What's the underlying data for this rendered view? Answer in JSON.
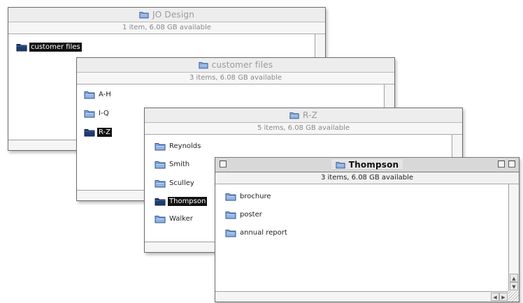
{
  "icons": {
    "folder": "folder-icon",
    "open_folder": "open-folder-icon"
  },
  "colors": {
    "selection": "#111111",
    "folder_blue": "#8fb4e6",
    "folder_dark": "#1f3c6e"
  },
  "windows": {
    "jo_design": {
      "title": "JO Design",
      "info": "1 item, 6.08 GB available",
      "items": [
        {
          "label": "customer files",
          "selected": true
        }
      ]
    },
    "customer_files": {
      "title": "customer files",
      "info": "3 items, 6.08 GB available",
      "items": [
        {
          "label": "A-H",
          "selected": false
        },
        {
          "label": "I-Q",
          "selected": false
        },
        {
          "label": "R-Z",
          "selected": true
        }
      ]
    },
    "r_z": {
      "title": "R-Z",
      "info": "5 items, 6.08 GB available",
      "items": [
        {
          "label": "Reynolds",
          "selected": false
        },
        {
          "label": "Smith",
          "selected": false
        },
        {
          "label": "Sculley",
          "selected": false
        },
        {
          "label": "Thompson",
          "selected": true
        },
        {
          "label": "Walker",
          "selected": false
        }
      ]
    },
    "thompson": {
      "title": "Thompson",
      "info": "3 items, 6.08 GB available",
      "items": [
        {
          "label": "brochure",
          "selected": false
        },
        {
          "label": "poster",
          "selected": false
        },
        {
          "label": "annual report",
          "selected": false
        }
      ]
    }
  }
}
